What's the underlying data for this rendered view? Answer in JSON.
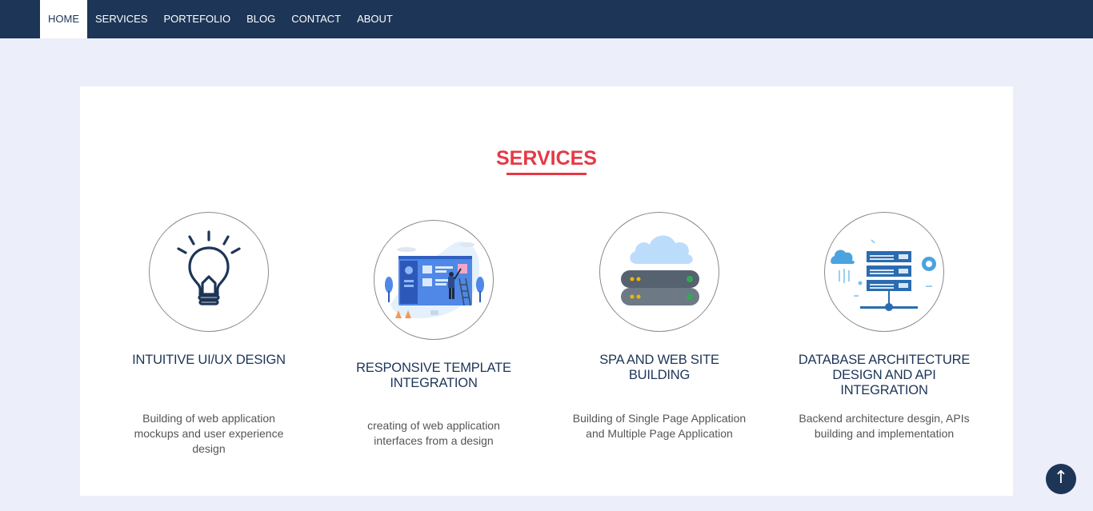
{
  "nav": {
    "items": [
      {
        "label": "HOME",
        "active": true
      },
      {
        "label": "SERVICES"
      },
      {
        "label": "PORTEFOLIO"
      },
      {
        "label": "BLOG"
      },
      {
        "label": "CONTACT"
      },
      {
        "label": "ABOUT"
      }
    ]
  },
  "services": {
    "title": "SERVICES",
    "items": [
      {
        "icon": "lightbulb-icon",
        "title": "INTUITIVE UI/UX DESIGN",
        "description": "Building of web application mockups and user experience design"
      },
      {
        "icon": "responsive-template-illustration",
        "title": "RESPONSIVE TEMPLATE INTEGRATION",
        "description": "creating of web application interfaces from a design"
      },
      {
        "icon": "cloud-server-icon",
        "title": "SPA AND WEB SITE BUILDING",
        "description": "Building of Single Page Application and Multiple Page Application"
      },
      {
        "icon": "database-network-icon",
        "title": "DATABASE ARCHITECTURE DESIGN AND API INTEGRATION",
        "description": "Backend architecture desgin, APIs building and implementation"
      }
    ]
  },
  "back_to_top": {
    "icon": "arrow-up-icon",
    "glyph": "↑"
  },
  "colors": {
    "navbar": "#1d3557",
    "accent": "#e63946",
    "background": "#eceef9"
  }
}
